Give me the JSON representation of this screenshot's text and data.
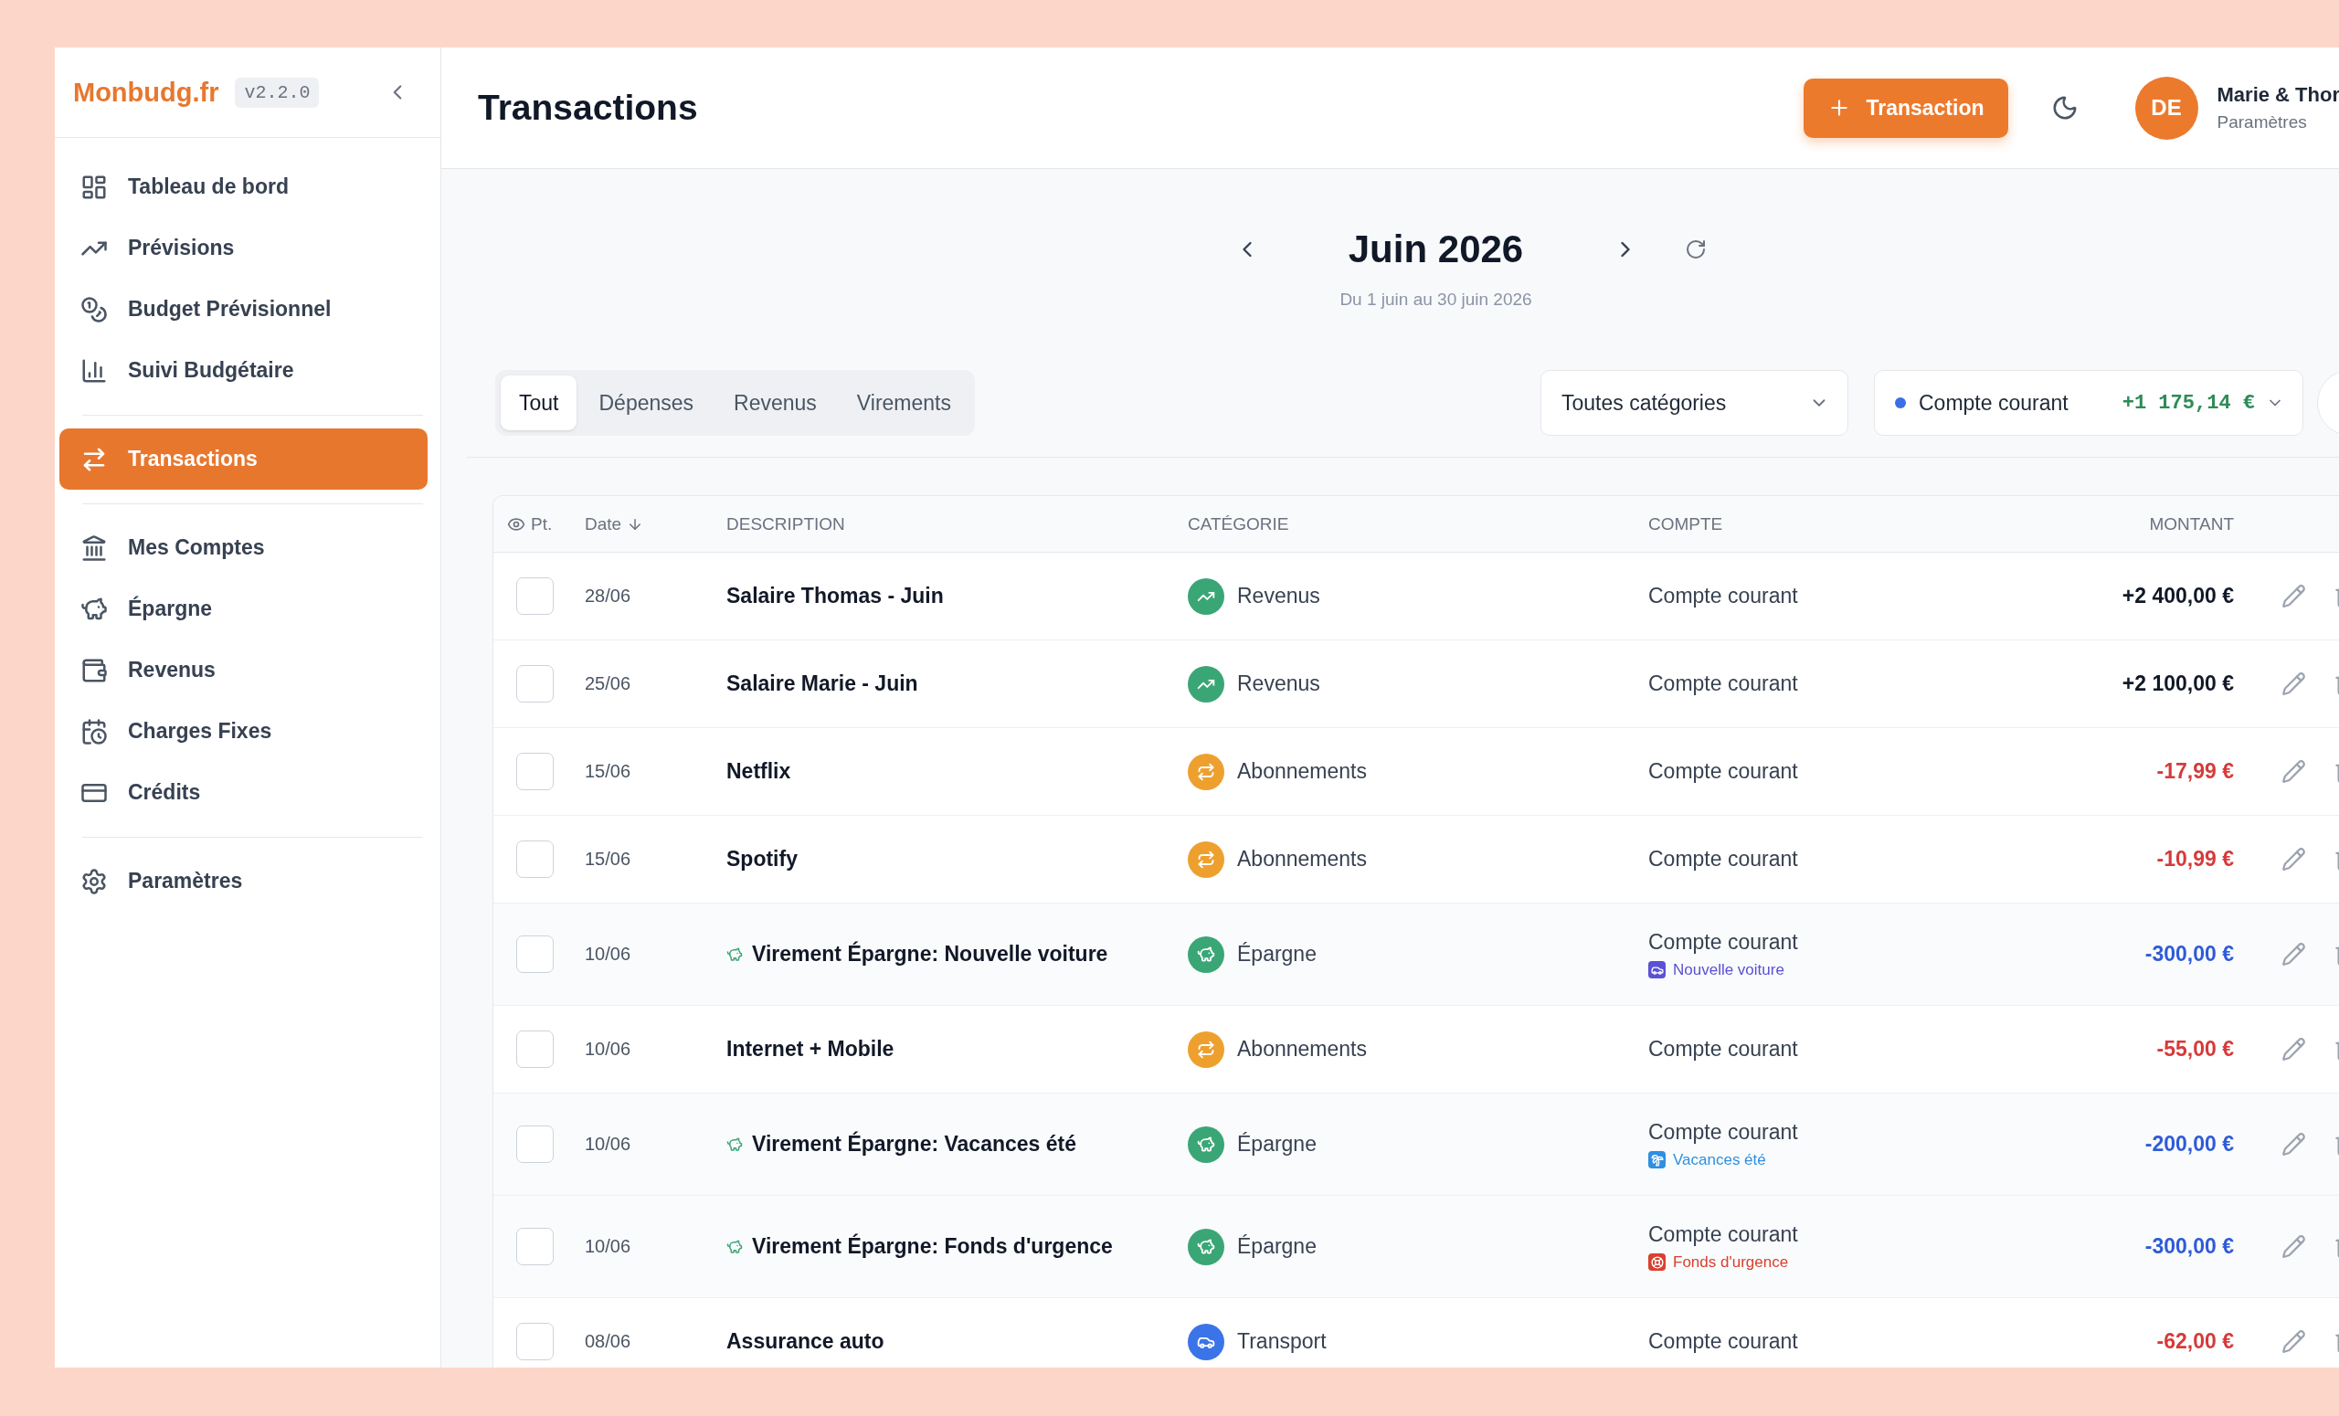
{
  "sidebar": {
    "logo": "Monbudg.fr",
    "version": "v2.2.0",
    "sections": [
      {
        "items": [
          {
            "label": "Tableau de bord",
            "selected": false
          },
          {
            "label": "Prévisions",
            "selected": false
          },
          {
            "label": "Budget Prévisionnel",
            "selected": false
          },
          {
            "label": "Suivi Budgétaire",
            "selected": false
          }
        ]
      },
      {
        "items": [
          {
            "label": "Transactions",
            "selected": true
          }
        ]
      },
      {
        "items": [
          {
            "label": "Mes Comptes",
            "selected": false
          },
          {
            "label": "Épargne",
            "selected": false
          },
          {
            "label": "Revenus",
            "selected": false
          },
          {
            "label": "Charges Fixes",
            "selected": false
          },
          {
            "label": "Crédits",
            "selected": false
          }
        ]
      },
      {
        "items": [
          {
            "label": "Paramètres",
            "selected": false
          }
        ]
      }
    ]
  },
  "header": {
    "title": "Transactions",
    "add_button": "Transaction",
    "user": {
      "initials": "DE",
      "name": "Marie & Thor",
      "link": "Paramètres"
    }
  },
  "period": {
    "title": "Juin 2026",
    "range": "Du 1 juin au 30 juin 2026"
  },
  "filters": {
    "tabs": [
      {
        "label": "Tout",
        "selected": true
      },
      {
        "label": "Dépenses",
        "selected": false
      },
      {
        "label": "Revenus",
        "selected": false
      },
      {
        "label": "Virements",
        "selected": false
      }
    ],
    "category": {
      "value": "Toutes catégories"
    },
    "account": {
      "name": "Compte courant",
      "balance": "+1 175,14 €",
      "color": "#3b6fe8"
    }
  },
  "table": {
    "columns": [
      {
        "label": "Pt.",
        "sorted": false
      },
      {
        "label": "Date",
        "sorted": true
      },
      {
        "label": "DESCRIPTION",
        "sorted": false
      },
      {
        "label": "CATÉGORIE",
        "sorted": false
      },
      {
        "label": "COMPTE",
        "sorted": false
      },
      {
        "label": "MONTANT",
        "sorted": false
      }
    ],
    "rows": [
      {
        "checked": false,
        "date": "28/06",
        "description": "Salaire Thomas - Juin",
        "kind": "income",
        "category": {
          "label": "Revenus",
          "kind": "income",
          "color": "#3aa676"
        },
        "account": "Compte courant",
        "amount": "+2 400,00 €"
      },
      {
        "checked": false,
        "date": "25/06",
        "description": "Salaire Marie - Juin",
        "kind": "income",
        "category": {
          "label": "Revenus",
          "kind": "income",
          "color": "#3aa676"
        },
        "account": "Compte courant",
        "amount": "+2 100,00 €"
      },
      {
        "checked": false,
        "date": "15/06",
        "description": "Netflix",
        "kind": "expense",
        "category": {
          "label": "Abonnements",
          "kind": "subscription",
          "color": "#eea02f"
        },
        "account": "Compte courant",
        "amount": "-17,99 €"
      },
      {
        "checked": false,
        "date": "15/06",
        "description": "Spotify",
        "kind": "expense",
        "category": {
          "label": "Abonnements",
          "kind": "subscription",
          "color": "#eea02f"
        },
        "account": "Compte courant",
        "amount": "-10,99 €"
      },
      {
        "checked": false,
        "date": "10/06",
        "description": "Virement Épargne: Nouvelle voiture",
        "kind": "transfer",
        "category": {
          "label": "Épargne",
          "kind": "savings",
          "color": "#3aa676"
        },
        "account": "Compte courant",
        "goal": {
          "label": "Nouvelle voiture",
          "kind": "vehicle",
          "color": "#5b50d6"
        },
        "amount": "-300,00 €"
      },
      {
        "checked": false,
        "date": "10/06",
        "description": "Internet + Mobile",
        "kind": "expense",
        "category": {
          "label": "Abonnements",
          "kind": "subscription",
          "color": "#eea02f"
        },
        "account": "Compte courant",
        "amount": "-55,00 €"
      },
      {
        "checked": false,
        "date": "10/06",
        "description": "Virement Épargne: Vacances été",
        "kind": "transfer",
        "category": {
          "label": "Épargne",
          "kind": "savings",
          "color": "#3aa676"
        },
        "account": "Compte courant",
        "goal": {
          "label": "Vacances été",
          "kind": "holiday",
          "color": "#2f8fe0"
        },
        "amount": "-200,00 €"
      },
      {
        "checked": false,
        "date": "10/06",
        "description": "Virement Épargne: Fonds d'urgence",
        "kind": "transfer",
        "category": {
          "label": "Épargne",
          "kind": "savings",
          "color": "#3aa676"
        },
        "account": "Compte courant",
        "goal": {
          "label": "Fonds d'urgence",
          "kind": "emergency",
          "color": "#d9402f"
        },
        "amount": "-300,00 €"
      },
      {
        "checked": false,
        "date": "08/06",
        "description": "Assurance auto",
        "kind": "expense",
        "category": {
          "label": "Transport",
          "kind": "transport",
          "color": "#3b74e8"
        },
        "account": "Compte courant",
        "amount": "-62,00 €"
      }
    ]
  }
}
